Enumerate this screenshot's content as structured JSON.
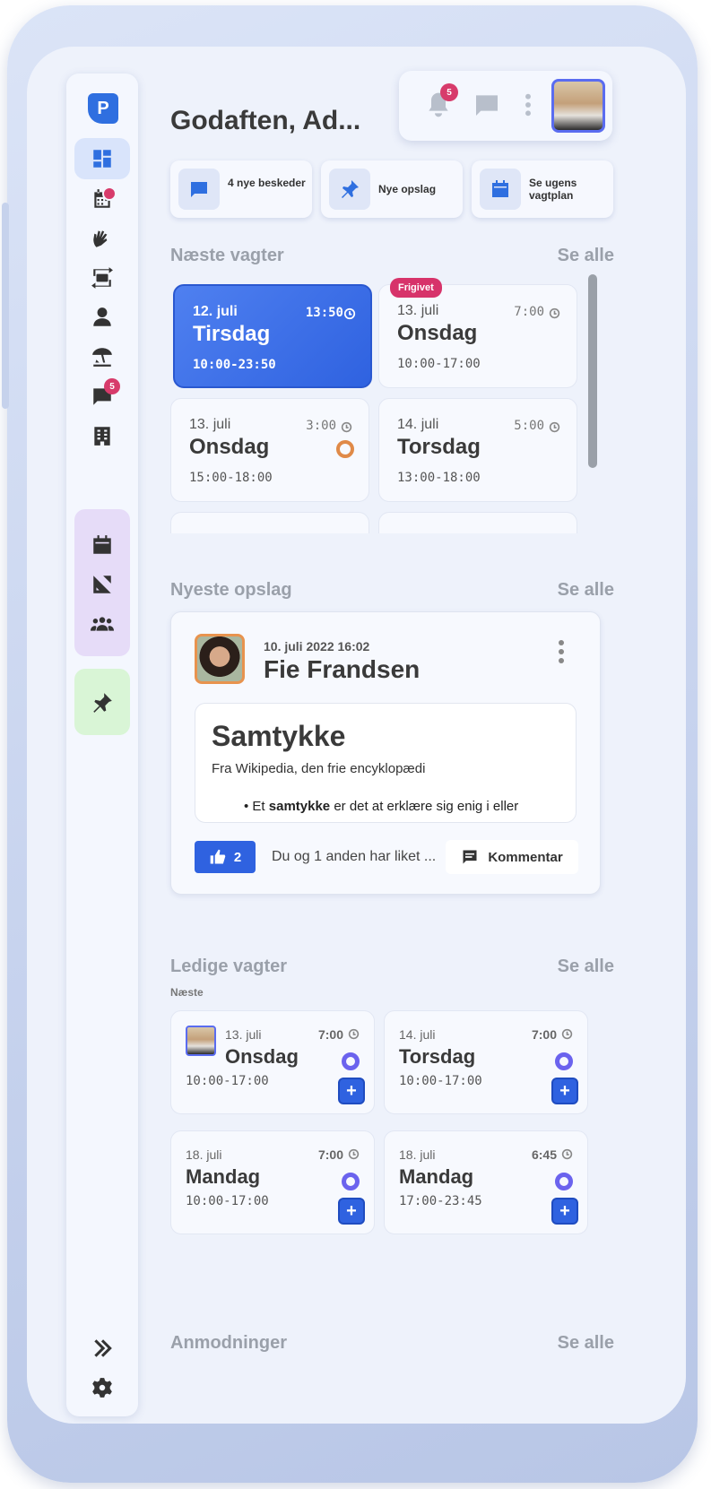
{
  "header": {
    "greeting": "Godaften, Ad...",
    "notification_count": "5"
  },
  "sidebar": {
    "logo": "P",
    "messages_count": "5",
    "items": [
      "dashboard-icon",
      "calendar-icon",
      "hands-icon",
      "swap-icon",
      "person-icon",
      "vacation-icon",
      "chat-icon",
      "building-icon",
      "calendar-icon",
      "ruler-icon",
      "group-icon",
      "pin-icon",
      "expand-icon",
      "gear-icon"
    ]
  },
  "quick": [
    {
      "label": "4 nye beskeder"
    },
    {
      "label": "Nye opslag"
    },
    {
      "label": "Se ugens vagtplan"
    }
  ],
  "next": {
    "title": "Næste vagter",
    "see_all": "Se alle",
    "shifts": [
      {
        "date": "12. juli",
        "time": "13:50",
        "day": "Tirsdag",
        "hours": "10:00-23:50"
      },
      {
        "date": "13. juli",
        "time": "7:00",
        "day": "Onsdag",
        "hours": "10:00-17:00",
        "badge": "Frigivet"
      },
      {
        "date": "13. juli",
        "time": "3:00",
        "day": "Onsdag",
        "hours": "15:00-18:00"
      },
      {
        "date": "14. juli",
        "time": "5:00",
        "day": "Torsdag",
        "hours": "13:00-18:00"
      }
    ]
  },
  "posts": {
    "title": "Nyeste opslag",
    "see_all": "Se alle",
    "date": "10. juli 2022 16:02",
    "author": "Fie Frandsen",
    "content_title": "Samtykke",
    "content_sub": "Fra Wikipedia, den frie encyklopædi",
    "content_bullet_pre": "• Et ",
    "content_bullet_bold": "samtykke",
    "content_bullet_post": " er det at erklære sig enig i eller",
    "likes": "2",
    "liked_text": "Du og 1 anden har liket ...",
    "comment_label": "Kommentar"
  },
  "free": {
    "title": "Ledige vagter",
    "see_all": "Se alle",
    "subtitle": "Næste",
    "shifts": [
      {
        "date": "13. juli",
        "time": "7:00",
        "day": "Onsdag",
        "hours": "10:00-17:00"
      },
      {
        "date": "14. juli",
        "time": "7:00",
        "day": "Torsdag",
        "hours": "10:00-17:00"
      },
      {
        "date": "18. juli",
        "time": "7:00",
        "day": "Mandag",
        "hours": "10:00-17:00"
      },
      {
        "date": "18. juli",
        "time": "6:45",
        "day": "Mandag",
        "hours": "17:00-23:45"
      }
    ]
  },
  "requests": {
    "title": "Anmodninger",
    "see_all": "Se alle"
  },
  "colors": {
    "accent": "#2f62e0",
    "badge": "#d7336a",
    "purple_ring": "#6b63ee"
  }
}
